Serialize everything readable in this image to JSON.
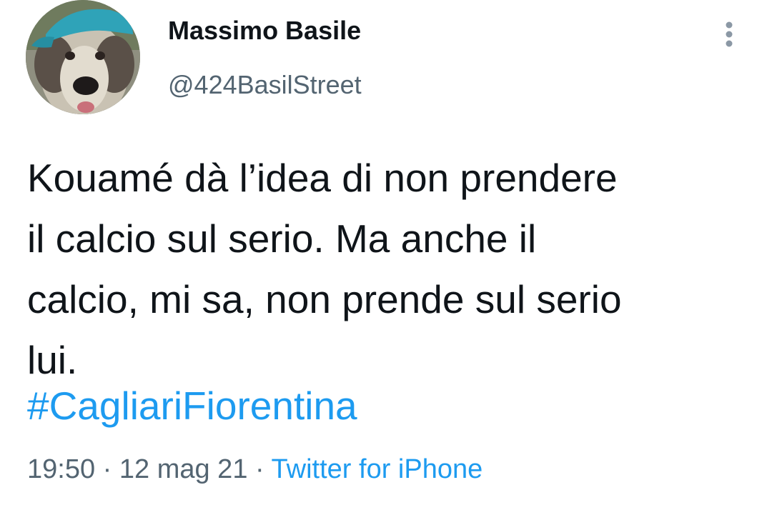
{
  "author": {
    "display_name": "Massimo Basile",
    "handle": "@424BasilStreet",
    "avatar_icon": "dog-with-cap-avatar"
  },
  "tweet": {
    "text_lines": [
      "Kouamé dà l’idea di non prendere",
      "il calcio sul serio. Ma anche il",
      "calcio, mi sa, non prende sul serio",
      "lui."
    ],
    "hashtag": "#CagliariFiorentina",
    "time": "19:50",
    "separator": "·",
    "date": "12 mag 21",
    "source": "Twitter for iPhone"
  },
  "icons": {
    "more": "more-vertical-icon"
  },
  "colors": {
    "text": "#0f1419",
    "secondary": "#536471",
    "link": "#1d9bf0",
    "background": "#ffffff"
  }
}
